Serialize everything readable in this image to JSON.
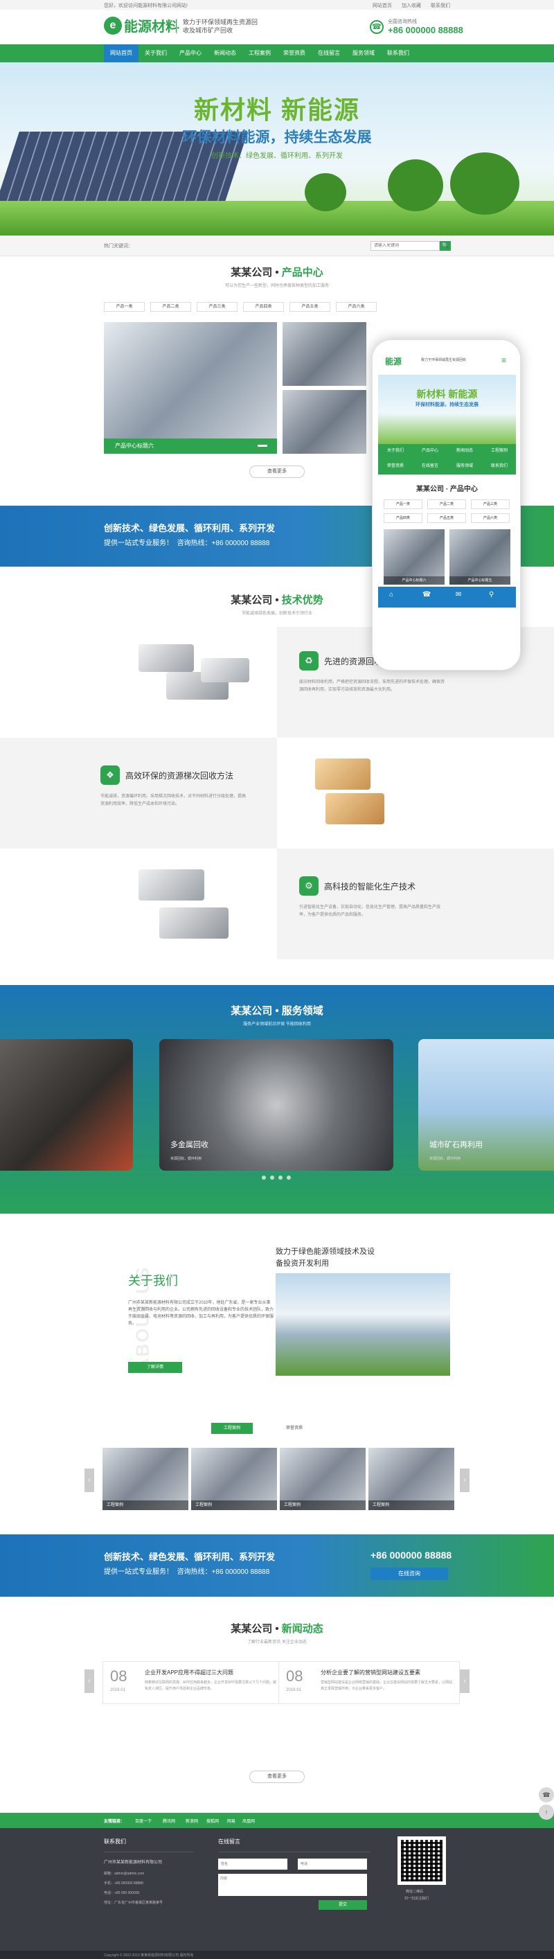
{
  "topbar": {
    "welcome": "您好，欢迎访问能源材料有限公司网站!",
    "links": [
      "网站首页",
      "加入收藏",
      "联系我们"
    ]
  },
  "header": {
    "logo_text": "能源材料",
    "slogan": "致力于环保领域再生资源回收及城市矿产回收",
    "hotline_label": "全国咨询热线",
    "hotline": "+86 000000 88888"
  },
  "nav": [
    "网站首页",
    "关于我们",
    "产品中心",
    "新闻动态",
    "工程案例",
    "荣誉资质",
    "在线留言",
    "服务领域",
    "联系我们"
  ],
  "banner": {
    "title": "新材料 新能源",
    "subtitle": "环保材料能源，持续生态发展",
    "tags": "创新技术、绿色发展、循环利用、系列开发"
  },
  "search": {
    "hot": "热门关键词：",
    "placeholder": "请输入关键词",
    "btn": "🔍"
  },
  "products": {
    "company": "某某公司",
    "title": "产品中心",
    "sub": "可以为您生产一些新型，同时也承接各种类型的加工服务",
    "tabs": [
      "产品一类",
      "产品二类",
      "产品三类",
      "产品四类",
      "产品五类",
      "产品六类"
    ],
    "feature": "产品中心标题六",
    "more": "查看更多"
  },
  "band1": {
    "line1": "创新技术、绿色发展、循环利用、系列开发",
    "line2": "提供一站式专业服务！",
    "tel_label": "咨询热线：",
    "tel": "+86 000000 88888"
  },
  "advantages": {
    "company": "某某公司",
    "title": "技术优势",
    "sub": "节能减排绿色发展，创新技术引领行业",
    "items": [
      {
        "title": "先进的资源回收工艺",
        "desc": "废旧材料回收利用，严格把控资源回收流程，采用先进的环保技术处理，确保资源回收再利用，实现零污染排放和资源最大化利用。"
      },
      {
        "title": "高效环保的资源梯次回收方法",
        "desc": "节能减排，资源循环利用，采用梯次回收技术，对不同材料进行分级处理，提高资源利用效率，降低生产成本和环境污染。"
      },
      {
        "title": "高科技的智能化生产技术",
        "desc": "引进智能化生产设备，实现自动化、信息化生产管理，提高产品质量和生产效率，为客户提供优质的产品和服务。"
      }
    ]
  },
  "service": {
    "company": "某某公司",
    "title": "服务领域",
    "sub": "服务产业领域前沿环保 节能回收利用",
    "cards": [
      {
        "title": "",
        "desc": ""
      },
      {
        "title": "多金属回收",
        "desc": "资源回收，循环利用"
      },
      {
        "title": "城市矿石再利用",
        "desc": "资源回收，循环利用"
      }
    ]
  },
  "about": {
    "tagline": "致力于绿色能源领域技术及设备投资开发利用",
    "title": "关于我们",
    "watermark": "ABOUT US",
    "desc": "广州市某某新能源材料有限公司成立于2010年，地处广东省，是一家专业从事再生资源回收与利用的企业。公司拥有先进的回收设备和专业的技术团队，致力于废旧金属、电池材料等资源的回收、加工与再利用，为客户提供优质的环保服务。",
    "btn": "了解详情"
  },
  "cases": {
    "tabs": [
      "工程案例",
      "荣誉资质"
    ],
    "items": [
      "工程案例",
      "工程案例",
      "工程案例",
      "工程案例",
      "工程案例"
    ]
  },
  "band2": {
    "line1": "创新技术、绿色发展、循环利用、系列开发",
    "line2": "提供一站式专业服务！",
    "tel_label": "咨询热线：",
    "tel": "+86 000000 88888",
    "btn": "在线咨询"
  },
  "news": {
    "company": "某某公司",
    "title": "新闻动态",
    "sub": "了解行业最新资讯 关注企业动态",
    "items": [
      {
        "day": "08",
        "ym": "2019-01",
        "title": "企业开发APP应用不得超过三大问题",
        "desc": "随着移动互联网的发展，APP应用越来越多，企业开发APP需要注意以下几个问题，避免走入误区，提升用户体验和企业品牌形象。"
      },
      {
        "day": "08",
        "ym": "2019-01",
        "title": "分析企业要了解的营销型网站建设五要素",
        "desc": "营销型网站建设是企业网络营销的基础，企业在建设网站时需要了解五大要素，让网站真正发挥营销作用，为企业带来更多客户。"
      }
    ],
    "more": "查看更多"
  },
  "footer": {
    "links_label": "友情链接：",
    "links": [
      "百度一下",
      "腾讯网",
      "新浪网",
      "搜狐网",
      "网易",
      "凤凰网"
    ],
    "contact_title": "联系我们",
    "company": "广州市某某新能源材料有限公司",
    "rows": [
      "邮箱：admin@admin.com",
      "手机：+86 000000 88888",
      "电话：+86 000 000000",
      "地址：广东省广州市番禺区某某路某号"
    ],
    "msg_title": "在线留言",
    "fields": [
      "姓名",
      "电话",
      "内容"
    ],
    "submit": "提交",
    "qr_label": "微信二维码",
    "qr_sub": "扫一扫关注我们",
    "copyright": "Copyright © 2002-2019 某某新能源材料有限公司 版权所有"
  },
  "phone": {
    "logo": "能源",
    "slogan": "致力于环保领域再生资源回收",
    "title": "新材料 新能源",
    "sub": "环保材料能源，持续生态发展",
    "menu": [
      "关于我们",
      "产品中心",
      "新闻动态",
      "工程案例",
      "荣誉资质",
      "在线留言",
      "服务领域",
      "联系我们"
    ],
    "sec": "某某公司 · 产品中心",
    "tabs": [
      "产品一类",
      "产品二类",
      "产品三类",
      "产品四类",
      "产品五类",
      "产品六类"
    ],
    "cards": [
      "产品中心标题六",
      "产品中心标题五"
    ],
    "bottom": [
      "首页",
      "电话",
      "微信",
      "地图"
    ]
  }
}
